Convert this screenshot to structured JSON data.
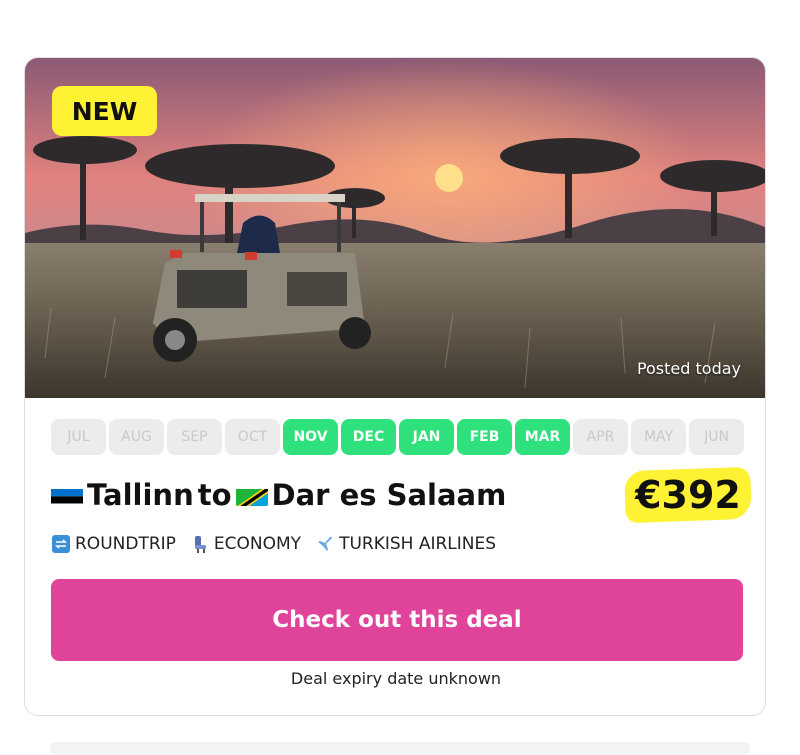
{
  "deal": {
    "badge": "NEW",
    "posted": "Posted today",
    "months": [
      {
        "label": "JUL",
        "active": false
      },
      {
        "label": "AUG",
        "active": false
      },
      {
        "label": "SEP",
        "active": false
      },
      {
        "label": "OCT",
        "active": false
      },
      {
        "label": "NOV",
        "active": true
      },
      {
        "label": "DEC",
        "active": true
      },
      {
        "label": "JAN",
        "active": true
      },
      {
        "label": "FEB",
        "active": true
      },
      {
        "label": "MAR",
        "active": true
      },
      {
        "label": "APR",
        "active": false
      },
      {
        "label": "MAY",
        "active": false
      },
      {
        "label": "JUN",
        "active": false
      }
    ],
    "origin": "Tallinn",
    "connector": "to",
    "destination": "Dar es Salaam",
    "origin_flag": "estonia-flag-icon",
    "destination_flag": "tanzania-flag-icon",
    "price": "€392",
    "tags": [
      {
        "icon": "roundtrip-icon",
        "label": "ROUNDTRIP"
      },
      {
        "icon": "seat-icon",
        "label": "ECONOMY"
      },
      {
        "icon": "airplane-icon",
        "label": "TURKISH AIRLINES"
      }
    ],
    "cta_label": "Check out this deal",
    "expiry": "Deal expiry date unknown"
  },
  "colors": {
    "active_month": "#2ee17c",
    "inactive_month": "#ececec",
    "highlight": "#fff133",
    "cta": "#e0449a"
  }
}
